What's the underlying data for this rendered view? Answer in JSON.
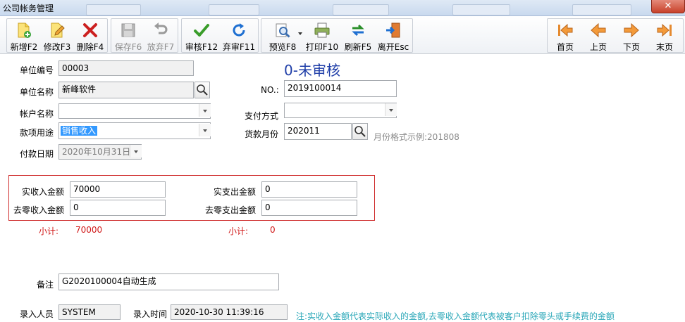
{
  "window": {
    "title": "公司帐务管理",
    "close_glyph": "✕"
  },
  "toolbar": {
    "buttons": [
      {
        "label": "新增F2",
        "icon": "new-doc-icon"
      },
      {
        "label": "修改F3",
        "icon": "edit-icon"
      },
      {
        "label": "删除F4",
        "icon": "delete-icon"
      },
      {
        "label": "保存F6",
        "icon": "save-icon"
      },
      {
        "label": "放弃F7",
        "icon": "undo-icon"
      },
      {
        "label": "审核F12",
        "icon": "check-icon"
      },
      {
        "label": "弃审F11",
        "icon": "refresh-blue-icon"
      },
      {
        "label": "预览F8",
        "icon": "preview-icon"
      },
      {
        "label": "打印F10",
        "icon": "printer-icon"
      },
      {
        "label": "刷新F5",
        "icon": "refresh-green-icon"
      },
      {
        "label": "离开Esc",
        "icon": "exit-icon"
      }
    ],
    "nav": [
      {
        "label": "首页",
        "icon": "first-page-icon"
      },
      {
        "label": "上页",
        "icon": "prev-page-icon"
      },
      {
        "label": "下页",
        "icon": "next-page-icon"
      },
      {
        "label": "末页",
        "icon": "last-page-icon"
      }
    ]
  },
  "form": {
    "status": "0-未审核",
    "unit_code_label": "单位编号",
    "unit_code": "00003",
    "unit_name_label": "单位名称",
    "unit_name": "新峰软件",
    "no_label": "NO.:",
    "no": "2019100014",
    "account_label": "帐户名称",
    "account": "",
    "pay_method_label": "支付方式",
    "pay_method": "",
    "purpose_label": "款项用途",
    "purpose": "销售收入",
    "month_label": "货款月份",
    "month": "202011",
    "month_hint": "月份格式示例:201808",
    "pay_date_label": "付款日期",
    "pay_date": "2020年10月31日",
    "actual_income_label": "实收入金额",
    "actual_income": "70000",
    "actual_expense_label": "实支出金额",
    "actual_expense": "0",
    "round_income_label": "去零收入金额",
    "round_income": "0",
    "round_expense_label": "去零支出金额",
    "round_expense": "0",
    "subtotal_label": "小计:",
    "subtotal_income": "70000",
    "subtotal_expense": "0",
    "remark_label": "备注",
    "remark": "G2020100004自动生成",
    "entry_user_label": "录入人员",
    "entry_user": "SYSTEM",
    "entry_time_label": "录入时间",
    "entry_time": "2020-10-30 11:39:16",
    "note": "注:实收入金额代表实际收入的金额,去零收入金额代表被客户扣除零头或手续费的金额"
  },
  "colors": {
    "status_blue": "#1f3ea8",
    "subtotal_red": "#d01818",
    "note_teal": "#2aa7b8",
    "box_red": "#cf2b2b"
  }
}
